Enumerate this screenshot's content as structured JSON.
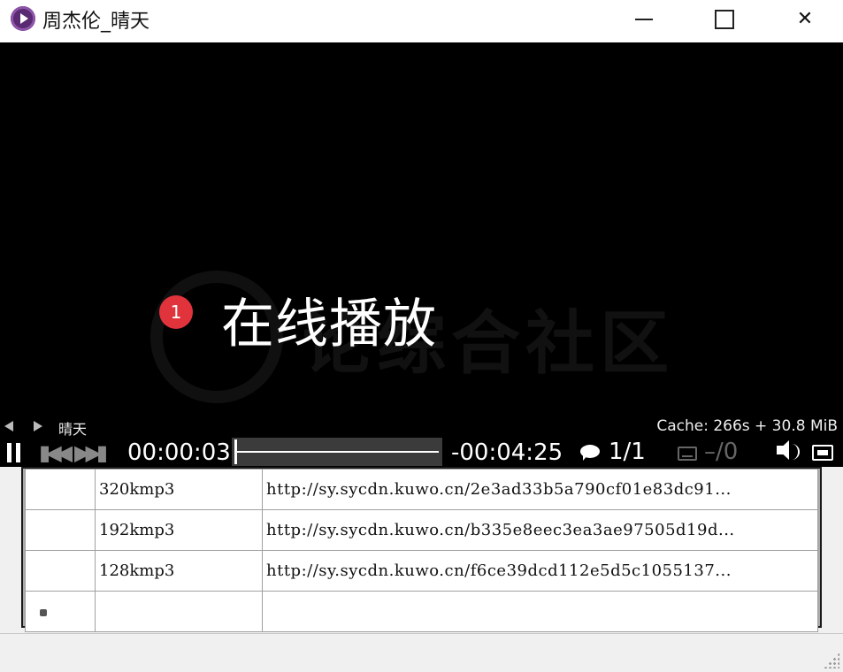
{
  "window": {
    "title": "周杰伦_晴天",
    "minimize_glyph": "",
    "maximize_glyph": "",
    "close_glyph": "✕"
  },
  "overlay": {
    "badge": "1",
    "label": "在线播放",
    "watermark": "论综合社区"
  },
  "controls": {
    "track_name": "晴天",
    "cache_info": "Cache: 266s +  30.8 MiB",
    "elapsed": "00:00:03",
    "remaining": "-00:04:25",
    "playlist_position": "1/1",
    "subtitle_track": "–/0",
    "progress": 0.011
  },
  "table": {
    "rows": [
      {
        "header": "",
        "quality": "320kmp3",
        "url": "http://sy.sycdn.kuwo.cn/2e3ad33b5a790cf01e83dc91..."
      },
      {
        "header": "",
        "quality": "192kmp3",
        "url": "http://sy.sycdn.kuwo.cn/b335e8eec3ea3ae97505d19d..."
      },
      {
        "header": "",
        "quality": "128kmp3",
        "url": "http://sy.sycdn.kuwo.cn/f6ce39dcd112e5d5c1055137..."
      },
      {
        "header": "",
        "quality": "",
        "url": ""
      }
    ]
  }
}
